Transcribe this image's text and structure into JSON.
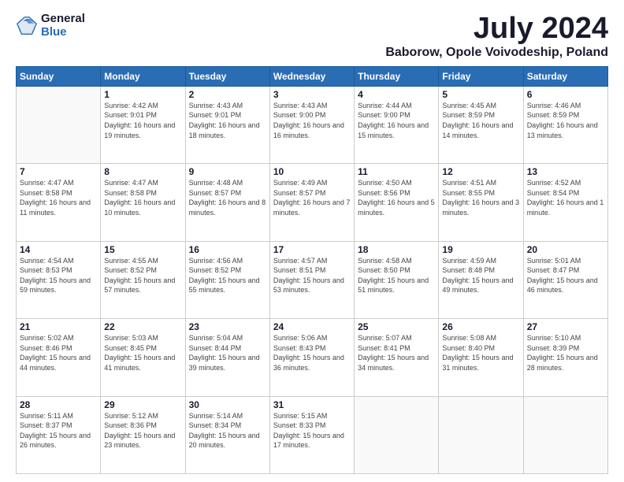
{
  "logo": {
    "general": "General",
    "blue": "Blue"
  },
  "title": "July 2024",
  "location": "Baborow, Opole Voivodeship, Poland",
  "days_of_week": [
    "Sunday",
    "Monday",
    "Tuesday",
    "Wednesday",
    "Thursday",
    "Friday",
    "Saturday"
  ],
  "weeks": [
    [
      {
        "day": "",
        "sunrise": "",
        "sunset": "",
        "daylight": ""
      },
      {
        "day": "1",
        "sunrise": "Sunrise: 4:42 AM",
        "sunset": "Sunset: 9:01 PM",
        "daylight": "Daylight: 16 hours and 19 minutes."
      },
      {
        "day": "2",
        "sunrise": "Sunrise: 4:43 AM",
        "sunset": "Sunset: 9:01 PM",
        "daylight": "Daylight: 16 hours and 18 minutes."
      },
      {
        "day": "3",
        "sunrise": "Sunrise: 4:43 AM",
        "sunset": "Sunset: 9:00 PM",
        "daylight": "Daylight: 16 hours and 16 minutes."
      },
      {
        "day": "4",
        "sunrise": "Sunrise: 4:44 AM",
        "sunset": "Sunset: 9:00 PM",
        "daylight": "Daylight: 16 hours and 15 minutes."
      },
      {
        "day": "5",
        "sunrise": "Sunrise: 4:45 AM",
        "sunset": "Sunset: 8:59 PM",
        "daylight": "Daylight: 16 hours and 14 minutes."
      },
      {
        "day": "6",
        "sunrise": "Sunrise: 4:46 AM",
        "sunset": "Sunset: 8:59 PM",
        "daylight": "Daylight: 16 hours and 13 minutes."
      }
    ],
    [
      {
        "day": "7",
        "sunrise": "Sunrise: 4:47 AM",
        "sunset": "Sunset: 8:58 PM",
        "daylight": "Daylight: 16 hours and 11 minutes."
      },
      {
        "day": "8",
        "sunrise": "Sunrise: 4:47 AM",
        "sunset": "Sunset: 8:58 PM",
        "daylight": "Daylight: 16 hours and 10 minutes."
      },
      {
        "day": "9",
        "sunrise": "Sunrise: 4:48 AM",
        "sunset": "Sunset: 8:57 PM",
        "daylight": "Daylight: 16 hours and 8 minutes."
      },
      {
        "day": "10",
        "sunrise": "Sunrise: 4:49 AM",
        "sunset": "Sunset: 8:57 PM",
        "daylight": "Daylight: 16 hours and 7 minutes."
      },
      {
        "day": "11",
        "sunrise": "Sunrise: 4:50 AM",
        "sunset": "Sunset: 8:56 PM",
        "daylight": "Daylight: 16 hours and 5 minutes."
      },
      {
        "day": "12",
        "sunrise": "Sunrise: 4:51 AM",
        "sunset": "Sunset: 8:55 PM",
        "daylight": "Daylight: 16 hours and 3 minutes."
      },
      {
        "day": "13",
        "sunrise": "Sunrise: 4:52 AM",
        "sunset": "Sunset: 8:54 PM",
        "daylight": "Daylight: 16 hours and 1 minute."
      }
    ],
    [
      {
        "day": "14",
        "sunrise": "Sunrise: 4:54 AM",
        "sunset": "Sunset: 8:53 PM",
        "daylight": "Daylight: 15 hours and 59 minutes."
      },
      {
        "day": "15",
        "sunrise": "Sunrise: 4:55 AM",
        "sunset": "Sunset: 8:52 PM",
        "daylight": "Daylight: 15 hours and 57 minutes."
      },
      {
        "day": "16",
        "sunrise": "Sunrise: 4:56 AM",
        "sunset": "Sunset: 8:52 PM",
        "daylight": "Daylight: 15 hours and 55 minutes."
      },
      {
        "day": "17",
        "sunrise": "Sunrise: 4:57 AM",
        "sunset": "Sunset: 8:51 PM",
        "daylight": "Daylight: 15 hours and 53 minutes."
      },
      {
        "day": "18",
        "sunrise": "Sunrise: 4:58 AM",
        "sunset": "Sunset: 8:50 PM",
        "daylight": "Daylight: 15 hours and 51 minutes."
      },
      {
        "day": "19",
        "sunrise": "Sunrise: 4:59 AM",
        "sunset": "Sunset: 8:48 PM",
        "daylight": "Daylight: 15 hours and 49 minutes."
      },
      {
        "day": "20",
        "sunrise": "Sunrise: 5:01 AM",
        "sunset": "Sunset: 8:47 PM",
        "daylight": "Daylight: 15 hours and 46 minutes."
      }
    ],
    [
      {
        "day": "21",
        "sunrise": "Sunrise: 5:02 AM",
        "sunset": "Sunset: 8:46 PM",
        "daylight": "Daylight: 15 hours and 44 minutes."
      },
      {
        "day": "22",
        "sunrise": "Sunrise: 5:03 AM",
        "sunset": "Sunset: 8:45 PM",
        "daylight": "Daylight: 15 hours and 41 minutes."
      },
      {
        "day": "23",
        "sunrise": "Sunrise: 5:04 AM",
        "sunset": "Sunset: 8:44 PM",
        "daylight": "Daylight: 15 hours and 39 minutes."
      },
      {
        "day": "24",
        "sunrise": "Sunrise: 5:06 AM",
        "sunset": "Sunset: 8:43 PM",
        "daylight": "Daylight: 15 hours and 36 minutes."
      },
      {
        "day": "25",
        "sunrise": "Sunrise: 5:07 AM",
        "sunset": "Sunset: 8:41 PM",
        "daylight": "Daylight: 15 hours and 34 minutes."
      },
      {
        "day": "26",
        "sunrise": "Sunrise: 5:08 AM",
        "sunset": "Sunset: 8:40 PM",
        "daylight": "Daylight: 15 hours and 31 minutes."
      },
      {
        "day": "27",
        "sunrise": "Sunrise: 5:10 AM",
        "sunset": "Sunset: 8:39 PM",
        "daylight": "Daylight: 15 hours and 28 minutes."
      }
    ],
    [
      {
        "day": "28",
        "sunrise": "Sunrise: 5:11 AM",
        "sunset": "Sunset: 8:37 PM",
        "daylight": "Daylight: 15 hours and 26 minutes."
      },
      {
        "day": "29",
        "sunrise": "Sunrise: 5:12 AM",
        "sunset": "Sunset: 8:36 PM",
        "daylight": "Daylight: 15 hours and 23 minutes."
      },
      {
        "day": "30",
        "sunrise": "Sunrise: 5:14 AM",
        "sunset": "Sunset: 8:34 PM",
        "daylight": "Daylight: 15 hours and 20 minutes."
      },
      {
        "day": "31",
        "sunrise": "Sunrise: 5:15 AM",
        "sunset": "Sunset: 8:33 PM",
        "daylight": "Daylight: 15 hours and 17 minutes."
      },
      {
        "day": "",
        "sunrise": "",
        "sunset": "",
        "daylight": ""
      },
      {
        "day": "",
        "sunrise": "",
        "sunset": "",
        "daylight": ""
      },
      {
        "day": "",
        "sunrise": "",
        "sunset": "",
        "daylight": ""
      }
    ]
  ]
}
